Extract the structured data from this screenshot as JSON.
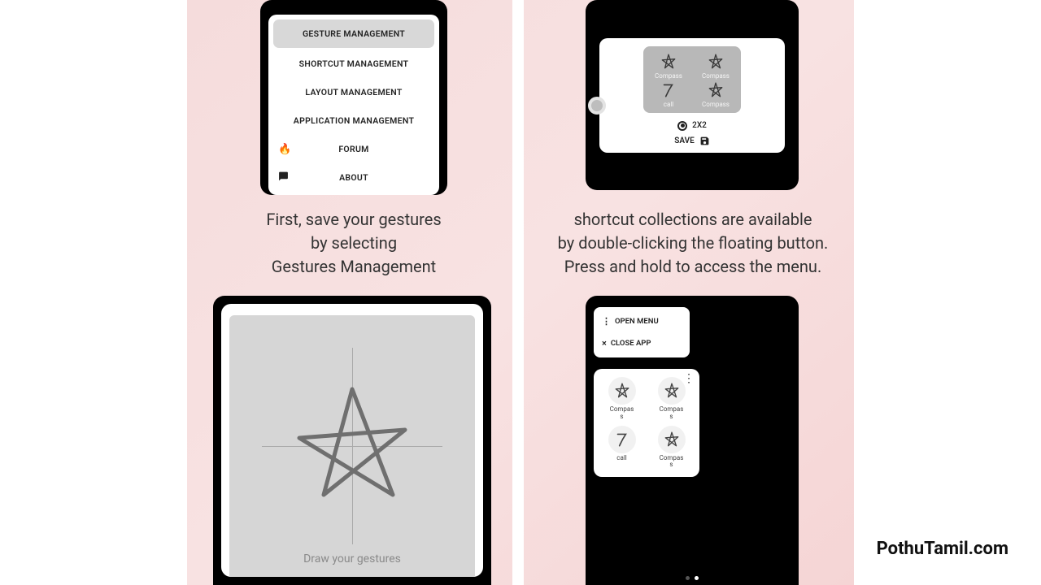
{
  "captions": {
    "left": "First, save your gestures\nby selecting\nGestures Management",
    "right": "shortcut collections are available\nby double-clicking the floating button.\nPress and hold to access the menu."
  },
  "menu": {
    "items": [
      {
        "label": "GESTURE MANAGEMENT",
        "selected": true
      },
      {
        "label": "SHORTCUT MANAGEMENT"
      },
      {
        "label": "LAYOUT MANAGEMENT"
      },
      {
        "label": "APPLICATION MANAGEMENT"
      },
      {
        "label": "FORUM",
        "icon": "flame"
      },
      {
        "label": "ABOUT",
        "icon": "chat"
      }
    ]
  },
  "grid": {
    "cells": [
      {
        "label": "Compass",
        "g": "star"
      },
      {
        "label": "Compass",
        "g": "star"
      },
      {
        "label": "call",
        "g": "seven"
      },
      {
        "label": "Compass",
        "g": "star"
      }
    ],
    "layout_label": "2X2",
    "save_label": "SAVE"
  },
  "draw": {
    "hint": "Draw your gestures"
  },
  "popup": {
    "items": [
      {
        "label": "OPEN MENU",
        "glyph": "⋮"
      },
      {
        "label": "CLOSE APP",
        "glyph": "×"
      }
    ],
    "grid": [
      {
        "label": "Compass",
        "g": "star"
      },
      {
        "label": "Compass",
        "g": "star"
      },
      {
        "label": "call",
        "g": "seven"
      },
      {
        "label": "Compass",
        "g": "star"
      }
    ]
  },
  "watermark": "PothuTamil.com"
}
